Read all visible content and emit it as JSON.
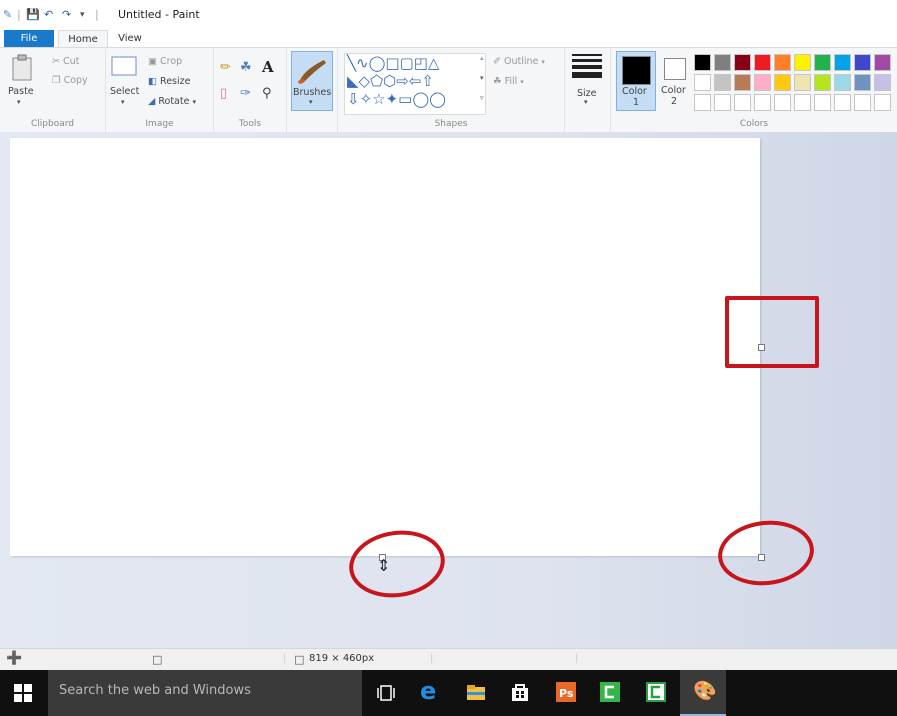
{
  "window": {
    "title": "Untitled - Paint"
  },
  "tabs": {
    "file": "File",
    "home": "Home",
    "view": "View"
  },
  "clipboard": {
    "paste": "Paste",
    "cut": "Cut",
    "copy": "Copy",
    "label": "Clipboard"
  },
  "image": {
    "select": "Select",
    "crop": "Crop",
    "resize": "Resize",
    "rotate": "Rotate",
    "label": "Image"
  },
  "tools": {
    "label": "Tools",
    "text_tool": "A"
  },
  "brushes": {
    "label": "Brushes"
  },
  "shapes": {
    "outline": "Outline",
    "fill": "Fill",
    "label": "Shapes"
  },
  "size": {
    "label": "Size"
  },
  "colors": {
    "color1_line1": "Color",
    "color1_line2": "1",
    "color2_line1": "Color",
    "color2_line2": "2",
    "label": "Colors",
    "color1": "#000000",
    "color2": "#ffffff",
    "palette_row1": [
      "#000000",
      "#7f7f7f",
      "#880015",
      "#ed1c24",
      "#ff7f27",
      "#fff200",
      "#22b14c",
      "#00a2e8",
      "#3f48cc",
      "#a349a4"
    ],
    "palette_row2": [
      "#ffffff",
      "#c3c3c3",
      "#b97a57",
      "#ffaec9",
      "#ffc90e",
      "#efe4b0",
      "#b5e61d",
      "#99d9ea",
      "#7092be",
      "#c8bfe7"
    ]
  },
  "statusbar": {
    "dimensions": "819 × 460px"
  },
  "taskbar": {
    "search_placeholder": "Search the web and Windows"
  },
  "accent": "#1979ca",
  "annotation_color": "#c8141b"
}
